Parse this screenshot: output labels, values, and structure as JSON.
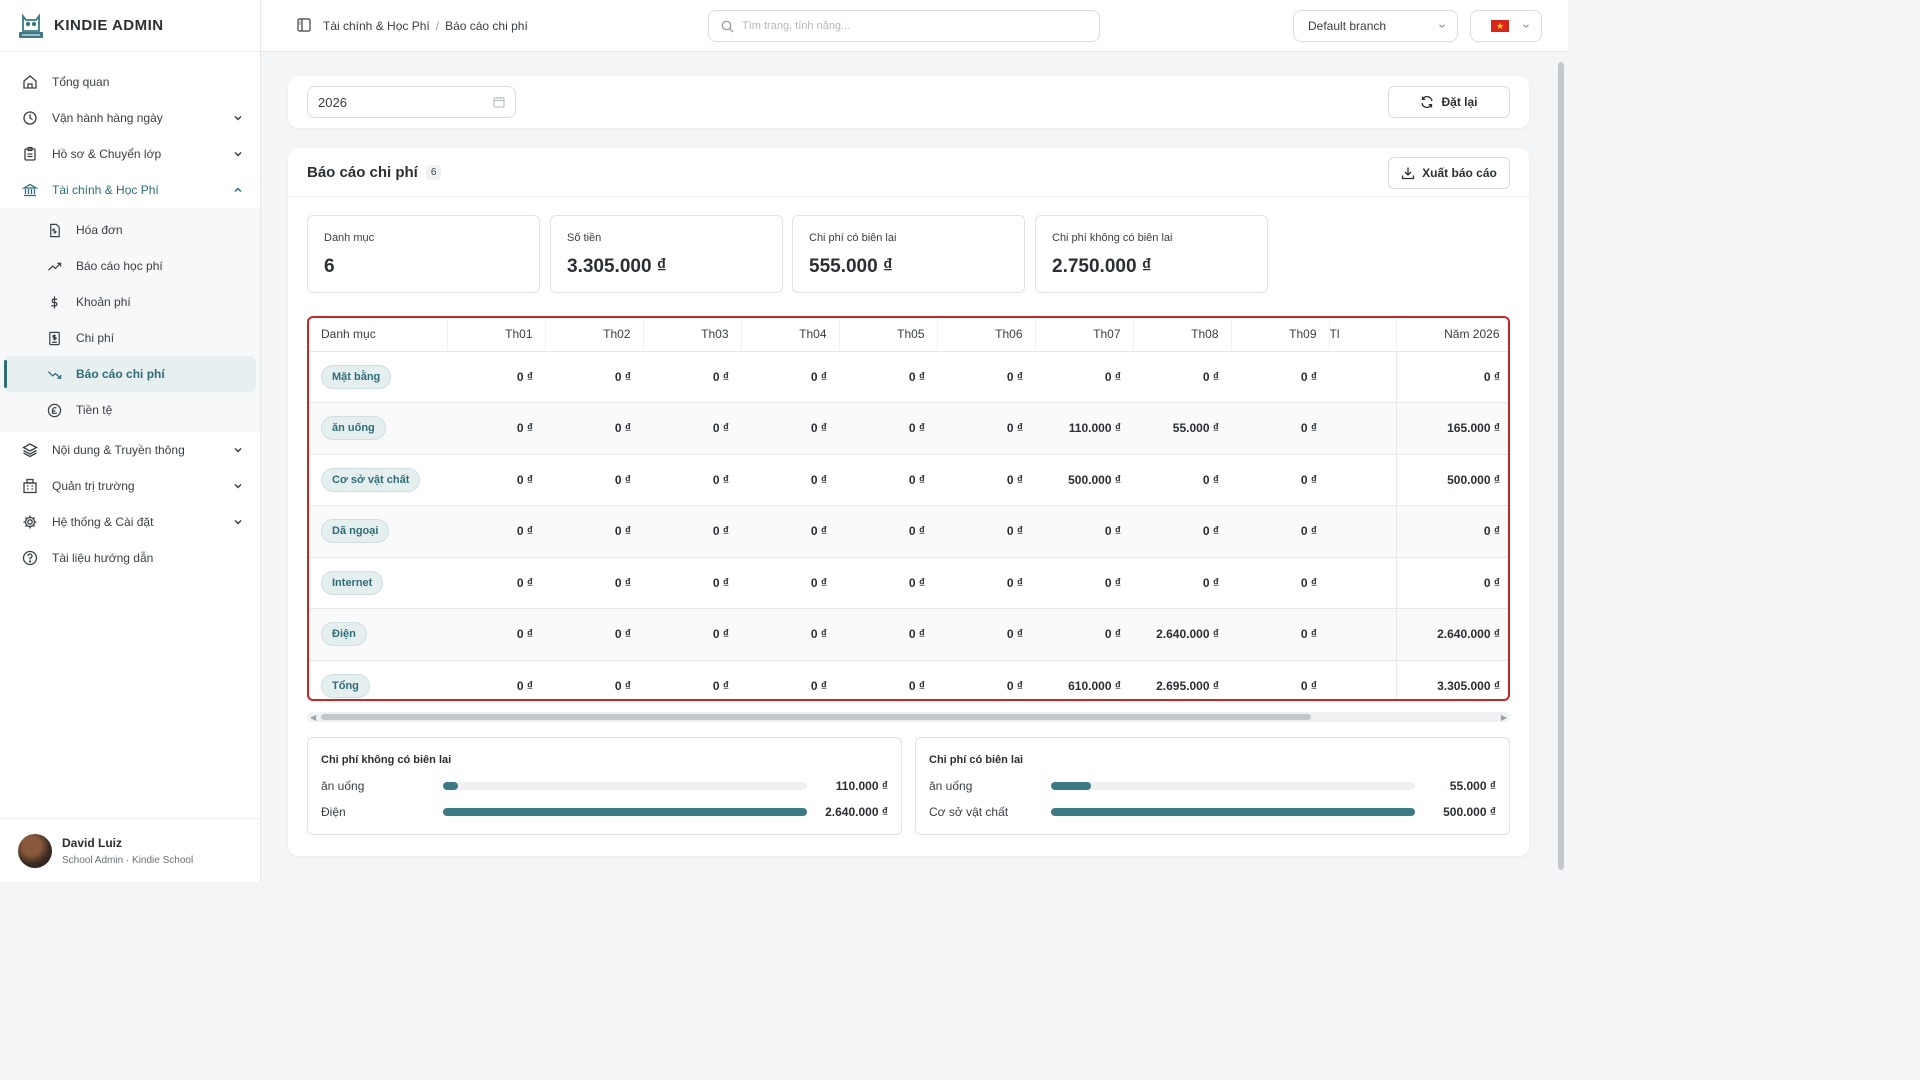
{
  "app": {
    "name": "KINDIE ADMIN"
  },
  "nav": {
    "items": [
      {
        "label": "Tổng quan"
      },
      {
        "label": "Vận hành hàng ngày"
      },
      {
        "label": "Hồ sơ & Chuyển lớp"
      },
      {
        "label": "Tài chính & Học Phí"
      },
      {
        "label": "Nội dung & Truyền thông"
      },
      {
        "label": "Quản trị trường"
      },
      {
        "label": "Hệ thống & Cài đặt"
      },
      {
        "label": "Tài liệu hướng dẫn"
      }
    ],
    "sub": [
      {
        "label": "Hóa đơn"
      },
      {
        "label": "Báo cáo học phí"
      },
      {
        "label": "Khoản phí"
      },
      {
        "label": "Chi phí"
      },
      {
        "label": "Báo cáo chi phí"
      },
      {
        "label": "Tiền tệ"
      }
    ]
  },
  "user": {
    "name": "David Luiz",
    "role": "School Admin · Kindie School"
  },
  "topbar": {
    "breadcrumb": [
      "Tài chính & Học Phí",
      "Báo cáo chi phí"
    ],
    "search_placeholder": "Tìm trang, tính năng...",
    "branch": "Default branch"
  },
  "filter": {
    "year": "2026",
    "reset_label": "Đặt lại"
  },
  "report": {
    "title": "Báo cáo chi phí",
    "count": "6",
    "export_label": "Xuất báo cáo",
    "stats": [
      {
        "label": "Danh mục",
        "value": "6"
      },
      {
        "label": "Số tiền",
        "value": "3.305.000 ₫"
      },
      {
        "label": "Chi phí có biên lai",
        "value": "555.000 ₫"
      },
      {
        "label": "Chi phí không có biên lai",
        "value": "2.750.000 ₫"
      }
    ],
    "table": {
      "headers": [
        "Danh mục",
        "Th01",
        "Th02",
        "Th03",
        "Th04",
        "Th05",
        "Th06",
        "Th07",
        "Th08",
        "Th09",
        "Tl",
        "Năm 2026"
      ],
      "rows": [
        {
          "cat": "Mặt bằng",
          "cells": [
            "0 ₫",
            "0 ₫",
            "0 ₫",
            "0 ₫",
            "0 ₫",
            "0 ₫",
            "0 ₫",
            "0 ₫",
            "0 ₫",
            "",
            "0 ₫"
          ]
        },
        {
          "cat": "ăn uống",
          "cells": [
            "0 ₫",
            "0 ₫",
            "0 ₫",
            "0 ₫",
            "0 ₫",
            "0 ₫",
            "110.000 ₫",
            "55.000 ₫",
            "0 ₫",
            "",
            "165.000 ₫"
          ]
        },
        {
          "cat": "Cơ sở vật chất",
          "cells": [
            "0 ₫",
            "0 ₫",
            "0 ₫",
            "0 ₫",
            "0 ₫",
            "0 ₫",
            "500.000 ₫",
            "0 ₫",
            "0 ₫",
            "",
            "500.000 ₫"
          ]
        },
        {
          "cat": "Dã ngoại",
          "cells": [
            "0 ₫",
            "0 ₫",
            "0 ₫",
            "0 ₫",
            "0 ₫",
            "0 ₫",
            "0 ₫",
            "0 ₫",
            "0 ₫",
            "",
            "0 ₫"
          ]
        },
        {
          "cat": "Internet",
          "cells": [
            "0 ₫",
            "0 ₫",
            "0 ₫",
            "0 ₫",
            "0 ₫",
            "0 ₫",
            "0 ₫",
            "0 ₫",
            "0 ₫",
            "",
            "0 ₫"
          ]
        },
        {
          "cat": "Điện",
          "cells": [
            "0 ₫",
            "0 ₫",
            "0 ₫",
            "0 ₫",
            "0 ₫",
            "0 ₫",
            "0 ₫",
            "2.640.000 ₫",
            "0 ₫",
            "",
            "2.640.000 ₫"
          ]
        },
        {
          "cat": "Tổng",
          "cells": [
            "0 ₫",
            "0 ₫",
            "0 ₫",
            "0 ₫",
            "0 ₫",
            "0 ₫",
            "610.000 ₫",
            "2.695.000 ₫",
            "0 ₫",
            "",
            "3.305.000 ₫"
          ]
        }
      ]
    },
    "no_receipt": {
      "title": "Chi phí không có biên lai",
      "items": [
        {
          "label": "ăn uống",
          "value": "110.000 ₫",
          "fraction": 0.042
        },
        {
          "label": "Điện",
          "value": "2.640.000 ₫",
          "fraction": 1.0
        }
      ]
    },
    "with_receipt": {
      "title": "Chi phí có biên lai",
      "items": [
        {
          "label": "ăn uống",
          "value": "55.000 ₫",
          "fraction": 0.11
        },
        {
          "label": "Cơ sở vật chất",
          "value": "500.000 ₫",
          "fraction": 1.0
        }
      ]
    }
  },
  "colors": {
    "accent": "#2e6d78",
    "bar": "#3b7a84",
    "highlight_border": "#c62828"
  }
}
